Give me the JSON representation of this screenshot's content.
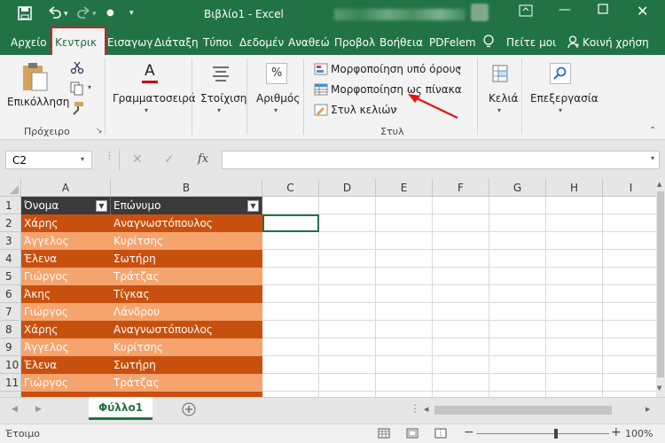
{
  "window": {
    "title": "Βιβλίο1  -  Excel"
  },
  "ribbon_tabs": [
    "Αρχείο",
    "Κεντρική",
    "Εισαγωγ",
    "Διάταξη",
    "Τύποι",
    "Δεδομέν",
    "Αναθεώ",
    "Προβολ",
    "Βοήθεια",
    "PDFelem"
  ],
  "active_tab": "Κεντρικ",
  "tell_me": "Πείτε μοι",
  "share": "Κοινή χρήση",
  "ribbon": {
    "paste": "Επικόλληση",
    "clipboard": "Πρόχειρο",
    "font": "Γραμματοσειρά",
    "alignment": "Στοίχιση",
    "number": "Αριθμός",
    "conditional": "Μορφοποίηση υπό όρους",
    "format_table": "Μορφοποίηση ως πίνακα",
    "cell_styles": "Στυλ κελιών",
    "styles": "Στυλ",
    "cells": "Κελιά",
    "editing": "Επεξεργασία",
    "percent": "%",
    "fx": "fx"
  },
  "namebox": "C2",
  "columns": [
    "A",
    "B",
    "C",
    "D",
    "E",
    "F",
    "G",
    "H",
    "I"
  ],
  "table_headers": [
    "Όνομα",
    "Επώνυμο"
  ],
  "rows": [
    {
      "n": "2",
      "a": "Χάρης",
      "b": "Αναγνωστόπουλος"
    },
    {
      "n": "3",
      "a": "Άγγελος",
      "b": "Κυρίτσης"
    },
    {
      "n": "4",
      "a": "Έλενα",
      "b": "Σωτήρη"
    },
    {
      "n": "5",
      "a": "Γιώργος",
      "b": "Τράτζας"
    },
    {
      "n": "6",
      "a": "Άκης",
      "b": "Τίγκας"
    },
    {
      "n": "7",
      "a": "Γιώργος",
      "b": "Λάνδρου"
    },
    {
      "n": "8",
      "a": "Χάρης",
      "b": "Αναγνωστόπουλος"
    },
    {
      "n": "9",
      "a": "Άγγελος",
      "b": "Κυρίτσης"
    },
    {
      "n": "10",
      "a": "Έλενα",
      "b": "Σωτήρη"
    },
    {
      "n": "11",
      "a": "Γιώργος",
      "b": "Τράτζας"
    }
  ],
  "header_row_num": "1",
  "sheet_tab": "Φύλλο1",
  "status": "Έτοιμο",
  "zoom": "100%",
  "colors": {
    "brand": "#217346",
    "dark_row": "#c8500e",
    "light_row": "#f6a46e",
    "header": "#3a3a3a",
    "highlight": "#d12020"
  }
}
